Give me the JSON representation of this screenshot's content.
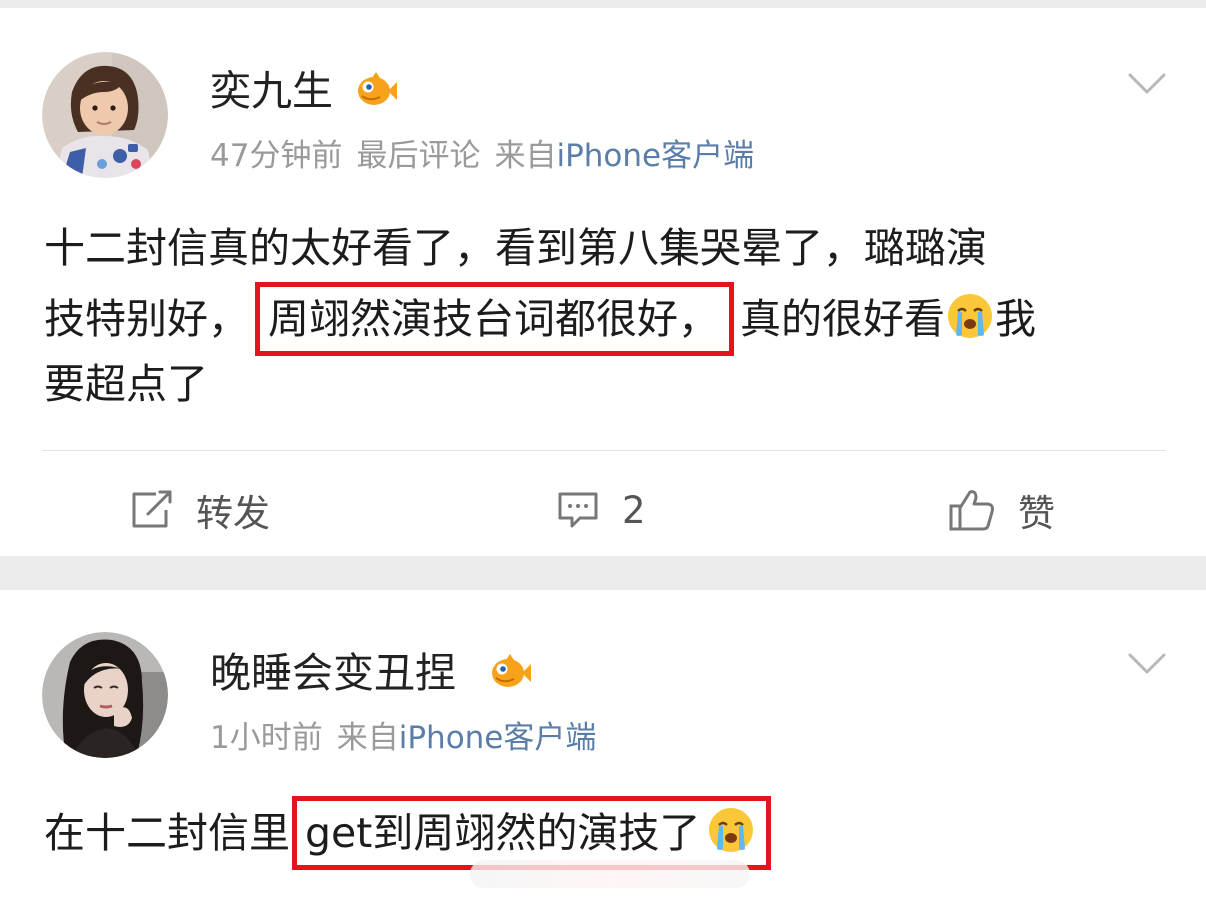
{
  "posts": [
    {
      "username": "奕九生",
      "meta": {
        "time": "47分钟前",
        "extra": "最后评论",
        "source_prefix": "来自",
        "source": "iPhone客户端"
      },
      "text": {
        "line1": "十二封信真的太好看了，看到第八集哭晕了，璐璐演",
        "line2_before": "技特别好，",
        "line2_highlight": "周翊然演技台词都很好，",
        "line2_after": "真的很好看",
        "line2_tail": "我",
        "line3": "要超点了"
      },
      "emoji": "crying-face-icon",
      "actions": {
        "repost_label": "转发",
        "comment_count": "2",
        "like_label": "赞"
      }
    },
    {
      "username": "晚睡会变丑捏",
      "meta": {
        "time": "1小时前",
        "source_prefix": "来自",
        "source": "iPhone客户端"
      },
      "text": {
        "before": "在十二封信里",
        "highlight": "get到周翊然的演技了"
      },
      "emoji": "crying-face-icon"
    }
  ],
  "colors": {
    "highlight_border": "#e3141b",
    "source_link": "#5a7ea8",
    "meta_gray": "#9a9a9a",
    "background": "#ececec"
  }
}
